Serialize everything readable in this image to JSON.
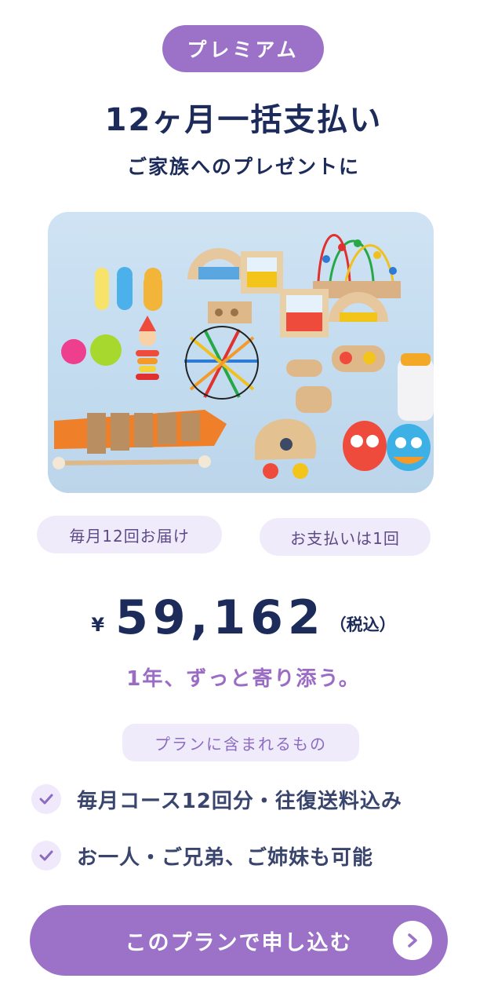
{
  "plan": {
    "badge": "プレミアム",
    "title": "12ヶ月一括支払い",
    "subtitle": "ご家族へのプレゼントに"
  },
  "hero_image": {
    "description_icon": "toys-photo"
  },
  "tags": {
    "delivery": "毎月12回お届け",
    "payment": "お支払いは1回"
  },
  "price": {
    "currency": "¥",
    "amount": "59,162",
    "tax_note": "（税込）"
  },
  "tagline": "1年、ずっと寄り添う。",
  "includes": {
    "label": "プランに含まれるもの",
    "items": [
      {
        "text": "毎月コース12回分・往復送料込み",
        "icon": "check-icon"
      },
      {
        "text": "お一人・ご兄弟、ご姉妹も可能",
        "icon": "check-icon"
      }
    ]
  },
  "cta": {
    "label": "このプランで申し込む",
    "icon": "chevron-right-icon"
  },
  "colors": {
    "accent": "#9b72c8",
    "navy": "#1c2b5a",
    "tag_bg": "#f0ebfb",
    "tagline": "#9a6cc4"
  }
}
